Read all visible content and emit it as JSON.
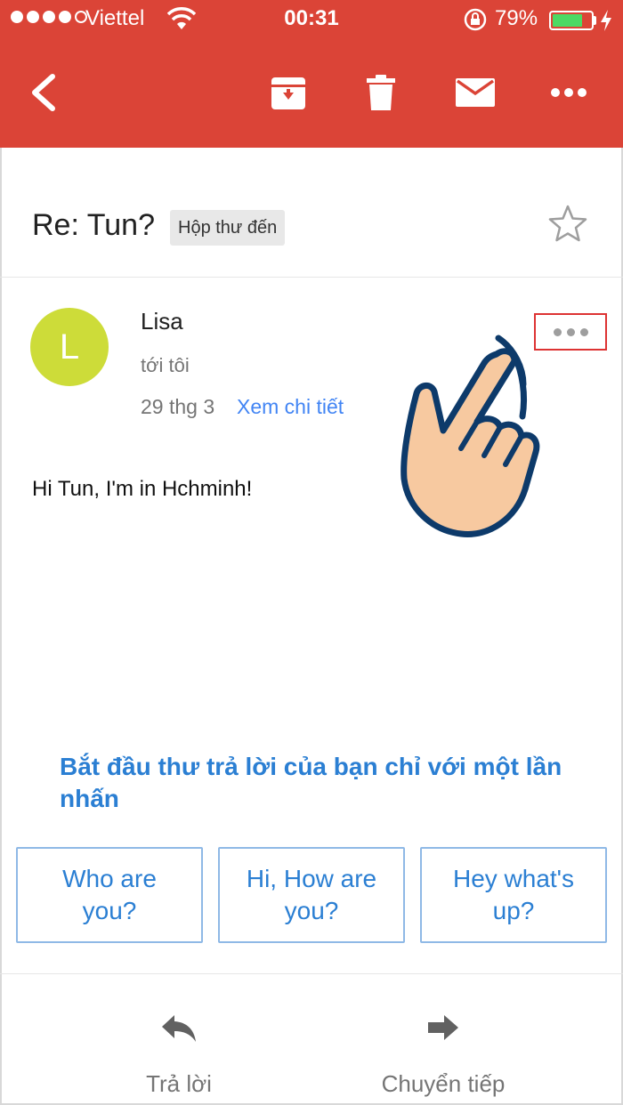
{
  "status_bar": {
    "carrier": "Viettel",
    "time": "00:31",
    "battery_percent": "79%",
    "battery_level": 0.79,
    "wifi_icon": "wifi-icon",
    "lock_icon": "rotation-lock-icon",
    "charging_icon": "bolt-icon"
  },
  "toolbar": {
    "back_icon": "back-arrow-icon",
    "archive_icon": "archive-icon",
    "delete_icon": "trash-icon",
    "mark_unread_icon": "mail-icon",
    "more_icon": "more-horizontal-icon"
  },
  "email": {
    "subject": "Re: Tun?",
    "label": "Hộp thư đến",
    "sender": "Lisa",
    "avatar_letter": "L",
    "recipient": "tới tôi",
    "date": "29 thg 3",
    "details_link": "Xem chi tiết",
    "body": "Hi Tun, I'm in Hchminh!"
  },
  "smart_reply": {
    "title": "Bắt đầu thư trả lời của bạn chỉ với một lần nhấn",
    "options": [
      "Who are you?",
      "Hi, How are you?",
      "Hey what's up?"
    ]
  },
  "bottom_bar": {
    "reply_label": "Trả lời",
    "forward_label": "Chuyển tiếp"
  },
  "colors": {
    "header": "#db4437",
    "link": "#4285f4",
    "smart_reply": "#2b7fd3",
    "avatar": "#cddc39",
    "highlight": "#dd3333"
  }
}
